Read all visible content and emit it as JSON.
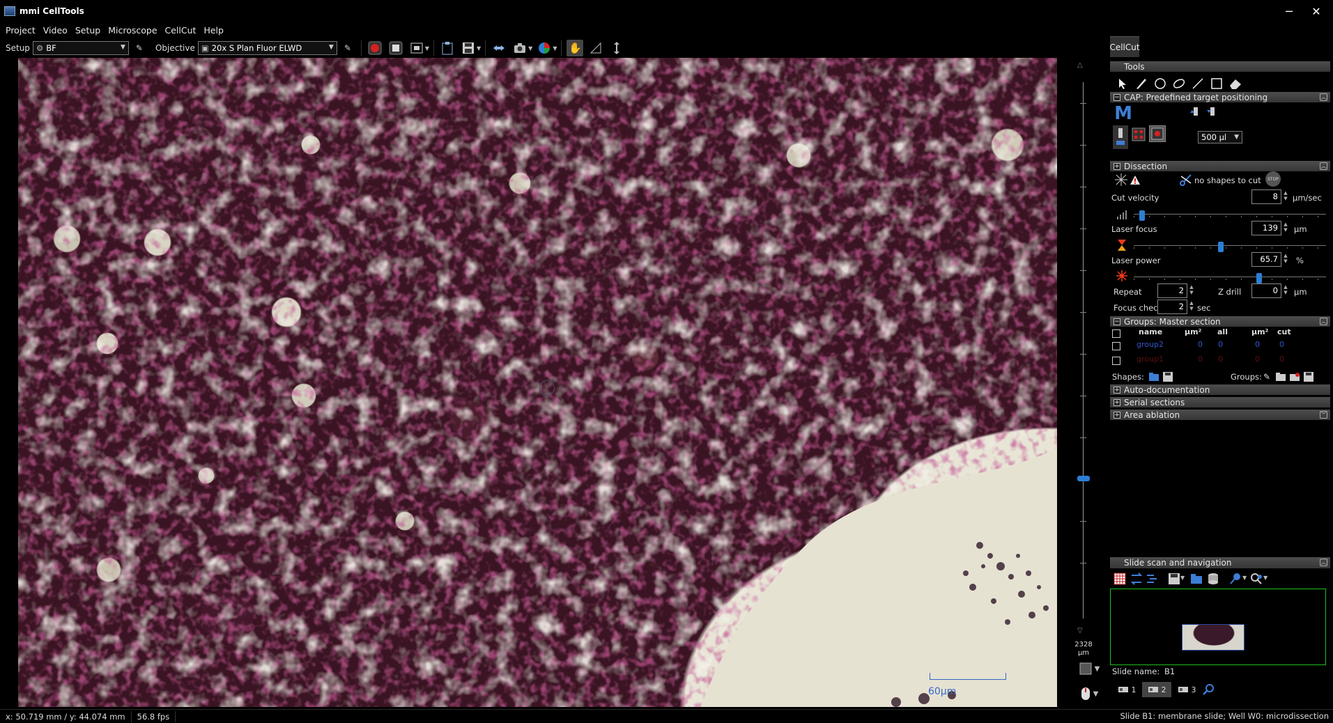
{
  "window": {
    "title": "mmi CellTools",
    "minimize": "─",
    "maximize": "☐",
    "close": "✕"
  },
  "menu": [
    "Project",
    "Video",
    "Setup",
    "Microscope",
    "CellCut",
    "Help"
  ],
  "toolbar": {
    "setup_label": "Setup",
    "setup_value": "BF",
    "objective_label": "Objective",
    "objective_value": "20x S Plan Fluor ELWD"
  },
  "viewport": {
    "scale_label": "60µm"
  },
  "zruler": {
    "value": "2328",
    "unit": "µm"
  },
  "panel": {
    "tab": "CellCut",
    "tools_header": "Tools",
    "cap_header": "CAP: Predefined target positioning",
    "cap_volume": "500 µl",
    "dissection_header": "Dissection",
    "no_shapes": "no shapes to cut",
    "cut_velocity_label": "Cut velocity",
    "cut_velocity_value": "8",
    "cut_velocity_unit": "µm/sec",
    "cut_velocity_level": 0.03,
    "laser_focus_label": "Laser focus",
    "laser_focus_value": "139",
    "laser_focus_unit": "µm",
    "laser_focus_level": 0.45,
    "laser_power_label": "Laser power",
    "laser_power_value": "65.7",
    "laser_power_unit": "%",
    "laser_power_level": 0.657,
    "repeat_label": "Repeat",
    "repeat_value": "2",
    "zdrill_label": "Z drill",
    "zdrill_value": "0",
    "zdrill_unit": "µm",
    "focus_check_label": "Focus check",
    "focus_check_value": "2",
    "focus_check_unit": "sec",
    "groups_header": "Groups: Master section",
    "groups_columns": [
      "name",
      "µm²",
      "all",
      "µm²",
      "cut"
    ],
    "groups": [
      {
        "name": "group2",
        "area": "0",
        "all": "0",
        "cut_area": "0",
        "cut": "0",
        "color": "#3355cc"
      },
      {
        "name": "group1",
        "area": "0",
        "all": "0",
        "cut_area": "0",
        "cut": "0",
        "color": "#5a1010"
      }
    ],
    "shapes_label": "Shapes:",
    "groups_label": "Groups:",
    "auto_doc_header": "Auto-documentation",
    "serial_header": "Serial sections",
    "ablation_header": "Area ablation",
    "slide_header": "Slide scan and navigation",
    "slide_name_label": "Slide name:",
    "slide_name_value": "B1",
    "slide_buttons": [
      "1",
      "2",
      "3"
    ]
  },
  "status": {
    "coords": "x: 50.719 mm / y: 44.074 mm",
    "fps": "56.8 fps",
    "slide_info": "Slide B1: membrane slide; Well W0: microdissection"
  },
  "colors": {
    "accent": "#2b7fd4",
    "tissue": "#3a1422",
    "nav_border": "#1ec01e"
  }
}
